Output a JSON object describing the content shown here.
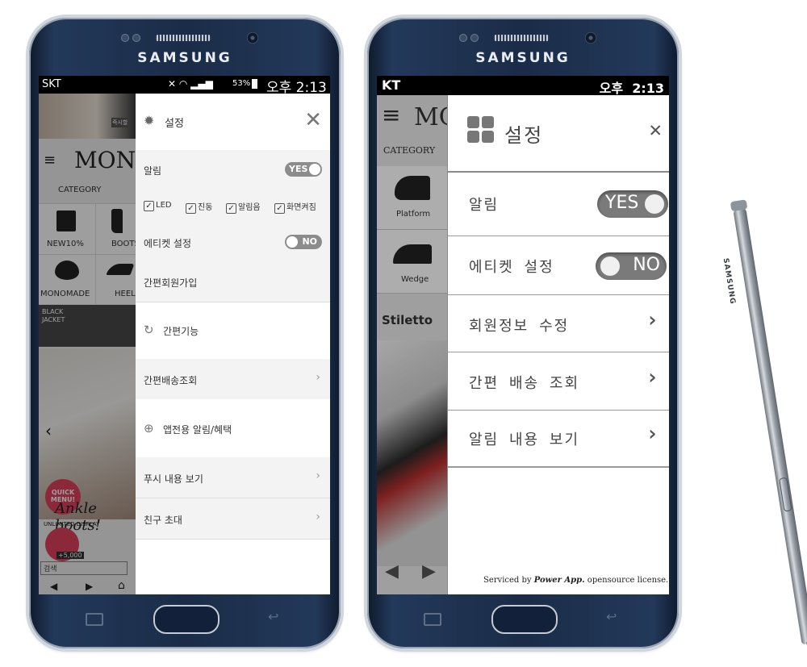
{
  "phone_left": {
    "brand": "SAMSUNG",
    "status": {
      "carrier": "SKT",
      "battery": "53%",
      "time": "오후 2:13"
    },
    "background_app": {
      "logo": "MONO",
      "category": "CATEGORY",
      "grid": [
        "NEW10%",
        "BOOTS",
        "MONOMADE",
        "HEEL"
      ],
      "banner": "BLACK JACKET",
      "badge": "즉시할",
      "quick_menu": "QUICK MENU!",
      "promo": "Ankle boots!",
      "promo_sub": "UNLIMITED DISPLAY",
      "points": "+5,000",
      "search": "검색"
    },
    "drawer": {
      "title": "설정",
      "alarm_label": "알림",
      "alarm_toggle": "YES",
      "checks": [
        "LED",
        "진동",
        "알림음",
        "화면켜짐"
      ],
      "etiquette_label": "에티켓 설정",
      "etiquette_toggle": "NO",
      "signup": "간편회원가입",
      "quick_title": "간편기능",
      "delivery": "간편배송조회",
      "app_alert": "앱전용 알림/혜택",
      "push": "푸시 내용 보기",
      "invite": "친구 초대"
    }
  },
  "phone_right": {
    "brand": "SAMSUNG",
    "status": {
      "carrier": "KT",
      "time": "오후  2:13"
    },
    "background_app": {
      "logo": "MC",
      "category": "CATEGORY",
      "items": [
        "Platform",
        "Wedge"
      ],
      "stiletto": "Stiletto"
    },
    "drawer": {
      "title": "설정",
      "alarm_label": "알림",
      "alarm_toggle": "YES",
      "etiquette_label": "에티켓 설정",
      "etiquette_toggle": "NO",
      "member": "회원정보 수정",
      "delivery": "간편 배송 조회",
      "alarm_view": "알림 내용 보기",
      "footer_prefix": "Serviced by",
      "footer_brand": "Power App.",
      "footer_suffix": "opensource license."
    }
  },
  "pen": {
    "label": "SAMSUNG"
  },
  "colors": {
    "phone_body": "#1c2d48",
    "toggle": "#8c8c8c",
    "dim": "#000000"
  }
}
